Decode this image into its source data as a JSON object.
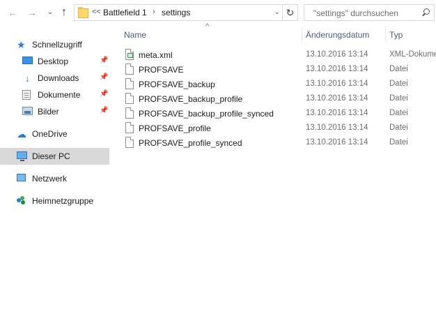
{
  "address_bar": {
    "overflow": "<<",
    "crumbs": [
      "Battlefield 1",
      "settings"
    ],
    "search_placeholder": "\"settings\" durchsuchen"
  },
  "sidebar": {
    "items": [
      {
        "label": "Schnellzugriff",
        "icon": "star-icon"
      },
      {
        "label": "Desktop",
        "icon": "desktop-icon",
        "pinned": true
      },
      {
        "label": "Downloads",
        "icon": "download-icon",
        "pinned": true
      },
      {
        "label": "Dokumente",
        "icon": "documents-icon",
        "pinned": true
      },
      {
        "label": "Bilder",
        "icon": "pictures-icon",
        "pinned": true
      },
      {
        "label": "OneDrive",
        "icon": "cloud-icon"
      },
      {
        "label": "Dieser PC",
        "icon": "computer-icon",
        "selected": true
      },
      {
        "label": "Netzwerk",
        "icon": "network-icon"
      },
      {
        "label": "Heimnetzgruppe",
        "icon": "homegroup-icon"
      }
    ]
  },
  "columns": {
    "name": "Name",
    "date": "Änderungsdatum",
    "type": "Typ"
  },
  "files": [
    {
      "name": "meta.xml",
      "date": "13.10.2016 13:14",
      "type": "XML-Dokument",
      "icon": "xml-file-icon"
    },
    {
      "name": "PROFSAVE",
      "date": "13.10.2016 13:14",
      "type": "Datei",
      "icon": "file-icon"
    },
    {
      "name": "PROFSAVE_backup",
      "date": "13.10.2016 13:14",
      "type": "Datei",
      "icon": "file-icon"
    },
    {
      "name": "PROFSAVE_backup_profile",
      "date": "13.10.2016 13:14",
      "type": "Datei",
      "icon": "file-icon"
    },
    {
      "name": "PROFSAVE_backup_profile_synced",
      "date": "13.10.2016 13:14",
      "type": "Datei",
      "icon": "file-icon"
    },
    {
      "name": "PROFSAVE_profile",
      "date": "13.10.2016 13:14",
      "type": "Datei",
      "icon": "file-icon"
    },
    {
      "name": "PROFSAVE_profile_synced",
      "date": "13.10.2016 13:14",
      "type": "Datei",
      "icon": "file-icon"
    }
  ]
}
